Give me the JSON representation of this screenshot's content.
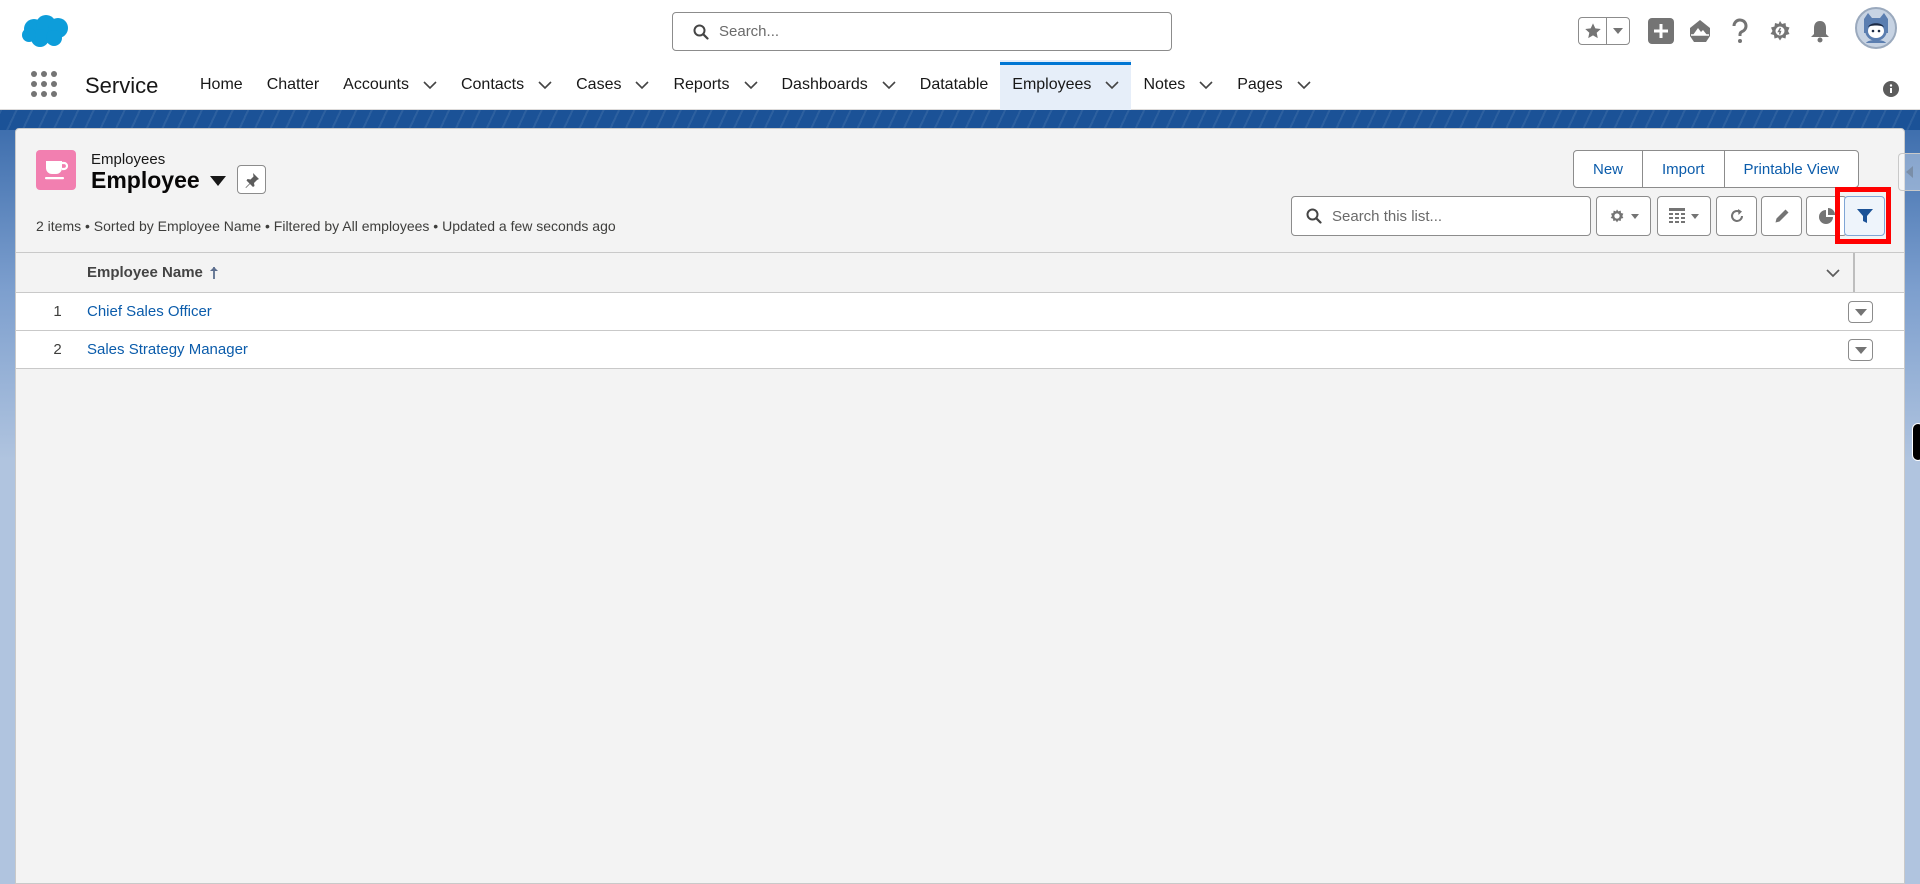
{
  "global_header": {
    "search_placeholder": "Search...",
    "icons": [
      "salesforce-cloud-logo",
      "favorites-star",
      "favorites-menu",
      "global-actions-plus",
      "trailhead-guidance",
      "help-question",
      "setup-gear",
      "notifications-bell",
      "user-avatar"
    ]
  },
  "nav": {
    "app_name": "Service",
    "items": [
      {
        "label": "Home",
        "has_menu": false
      },
      {
        "label": "Chatter",
        "has_menu": false
      },
      {
        "label": "Accounts",
        "has_menu": true
      },
      {
        "label": "Contacts",
        "has_menu": true
      },
      {
        "label": "Cases",
        "has_menu": true
      },
      {
        "label": "Reports",
        "has_menu": true
      },
      {
        "label": "Dashboards",
        "has_menu": true
      },
      {
        "label": "Datatable",
        "has_menu": false
      },
      {
        "label": "Employees",
        "has_menu": true,
        "active": true
      },
      {
        "label": "Notes",
        "has_menu": true
      },
      {
        "label": "Pages",
        "has_menu": true
      }
    ]
  },
  "list_view": {
    "object_label": "Employees",
    "view_name": "Employee",
    "meta": "2 items • Sorted by Employee Name • Filtered by All employees • Updated a few seconds ago",
    "buttons": {
      "new": "New",
      "import": "Import",
      "printable_view": "Printable View"
    },
    "search_placeholder": "Search this list...",
    "toolbar": [
      "list-view-controls-gear",
      "display-as-table",
      "refresh",
      "edit-list",
      "charts",
      "filters"
    ],
    "selected_tool": "filters",
    "table": {
      "columns": [
        {
          "label": "Employee Name",
          "sorted": "ascending"
        }
      ],
      "rows": [
        {
          "num": "1",
          "name": "Chief Sales Officer"
        },
        {
          "num": "2",
          "name": "Sales Strategy Manager"
        }
      ]
    }
  },
  "colors": {
    "brand_blue": "#0176d3",
    "link_blue": "#0b5cab",
    "object_icon_pink": "#f27fb0",
    "highlight_red": "#ff0000"
  }
}
